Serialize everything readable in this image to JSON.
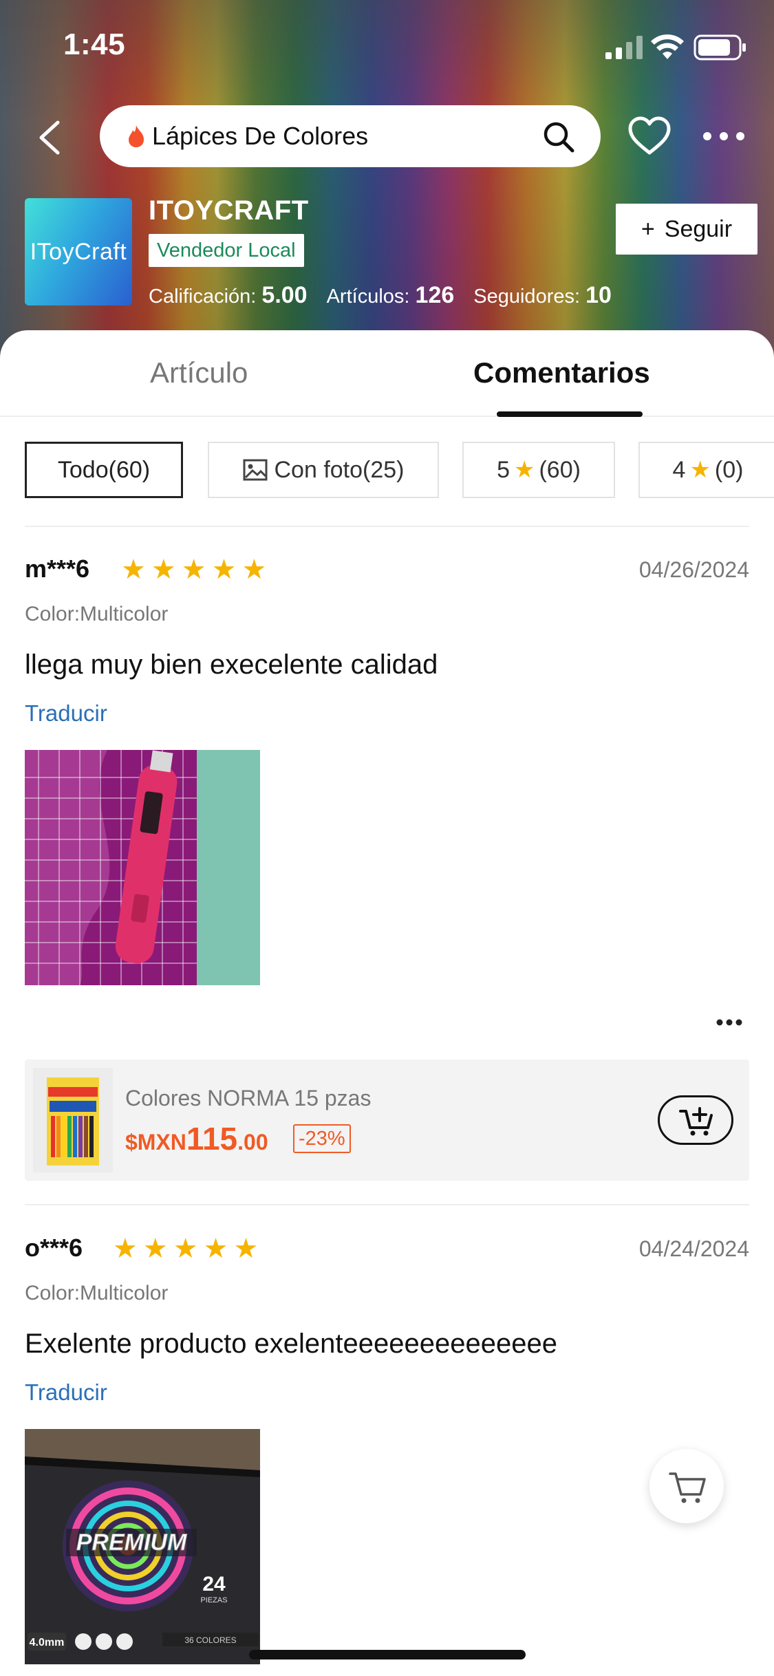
{
  "status_bar": {
    "time": "1:45"
  },
  "header": {
    "search_text": "Lápices De Colores",
    "icons": [
      "back-arrow-icon",
      "flame-icon",
      "search-icon",
      "heart-icon",
      "more-icon"
    ]
  },
  "shop": {
    "logo_text": "IToyCraft",
    "name": "ITOYCRAFT",
    "badge": "Vendedor Local",
    "rating_label": "Calificación:",
    "rating_value": "5.00",
    "items_label": "Artículos:",
    "items_value": "126",
    "followers_label": "Seguidores:",
    "followers_value": "10",
    "follow_label": "Seguir"
  },
  "tabs": {
    "articulo": "Artículo",
    "comentarios": "Comentarios",
    "active": "Comentarios"
  },
  "filters": [
    {
      "label": "Todo(60)",
      "active": true
    },
    {
      "label": "Con foto(25)",
      "icon": "image-icon"
    },
    {
      "prefix": "5",
      "suffix": "(60)",
      "icon": "star-icon"
    },
    {
      "prefix": "4",
      "suffix": "(0)",
      "icon": "star-icon"
    }
  ],
  "reviews": [
    {
      "user": "m***6",
      "rating": 5,
      "date": "04/26/2024",
      "color": "Color:Multicolor",
      "text": "llega muy bien execelente calidad",
      "translate": "Traducir",
      "photo": "photo of pink rotary tool on purple cutting mat"
    },
    {
      "user": "o***6",
      "rating": 5,
      "date": "04/24/2024",
      "color": "Color:Multicolor",
      "text": "Exelente producto exelenteeeeeeeeeeeeee",
      "translate": "Traducir",
      "photo": "photo of PREMIUM colored pencils box"
    }
  ],
  "product": {
    "name": "Colores NORMA 15 pzas",
    "currency": "$MXN",
    "price_int": "115",
    "price_dec": ".00",
    "discount": "-23%"
  },
  "colors": {
    "accent": "#f05a24",
    "star": "#f5b400",
    "link": "#2a6fb8",
    "badge_green": "#1a8a5a"
  }
}
